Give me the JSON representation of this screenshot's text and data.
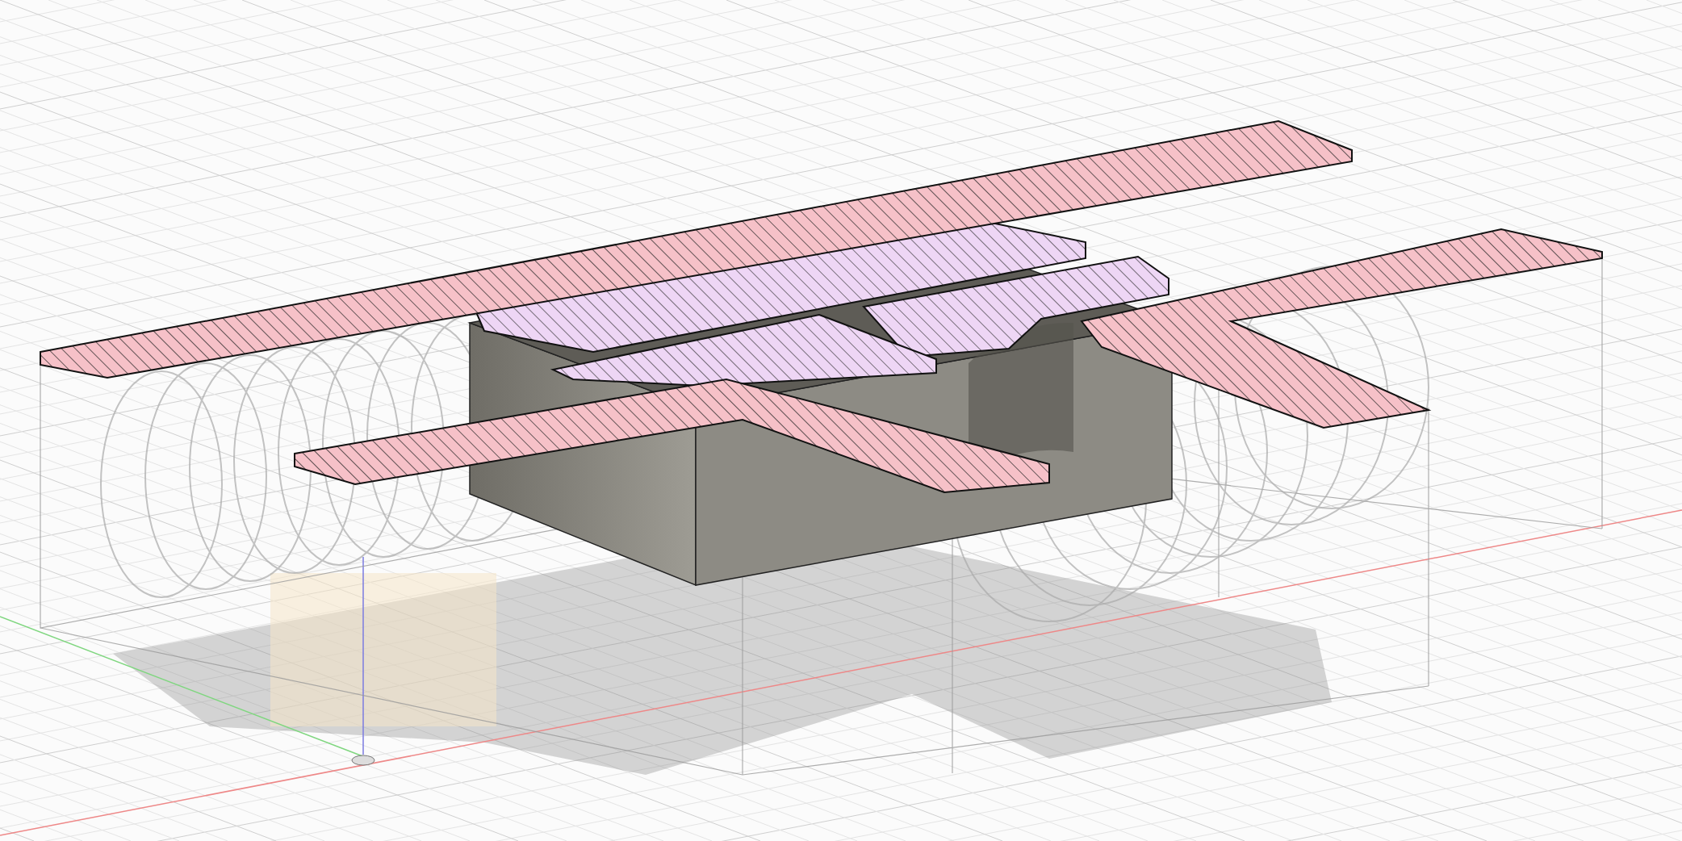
{
  "viewport": {
    "grid_visible": true
  }
}
